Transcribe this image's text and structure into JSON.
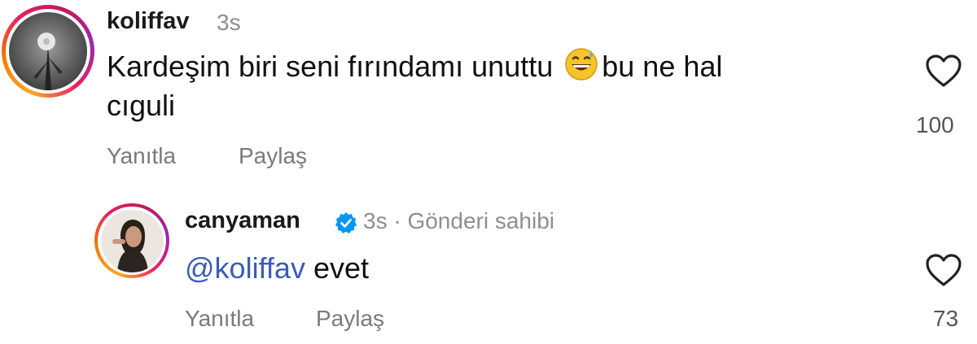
{
  "comments": [
    {
      "username": "koliffav",
      "time": "3s",
      "text_before_emoji": "Kardeşim biri seni fırındamı unuttu ",
      "emoji": "grinning-sweat-emoji",
      "text_after_emoji": "bu ne hal",
      "text_line2": "cıguli",
      "reply_label": "Yanıtla",
      "share_label": "Paylaş",
      "likes": "100"
    },
    {
      "username": "canyaman",
      "verified": true,
      "meta": "3s · Gönderi sahibi",
      "mention": "@koliffav",
      "text": " evet",
      "reply_label": "Yanıtla",
      "share_label": "Paylaş",
      "likes": "73"
    }
  ],
  "colors": {
    "mention": "#3b5bb5",
    "verified": "#0095f6",
    "muted_text": "#8e8e8e"
  },
  "icons": {
    "like": "heart-outline-icon",
    "verified": "verified-badge-icon"
  }
}
